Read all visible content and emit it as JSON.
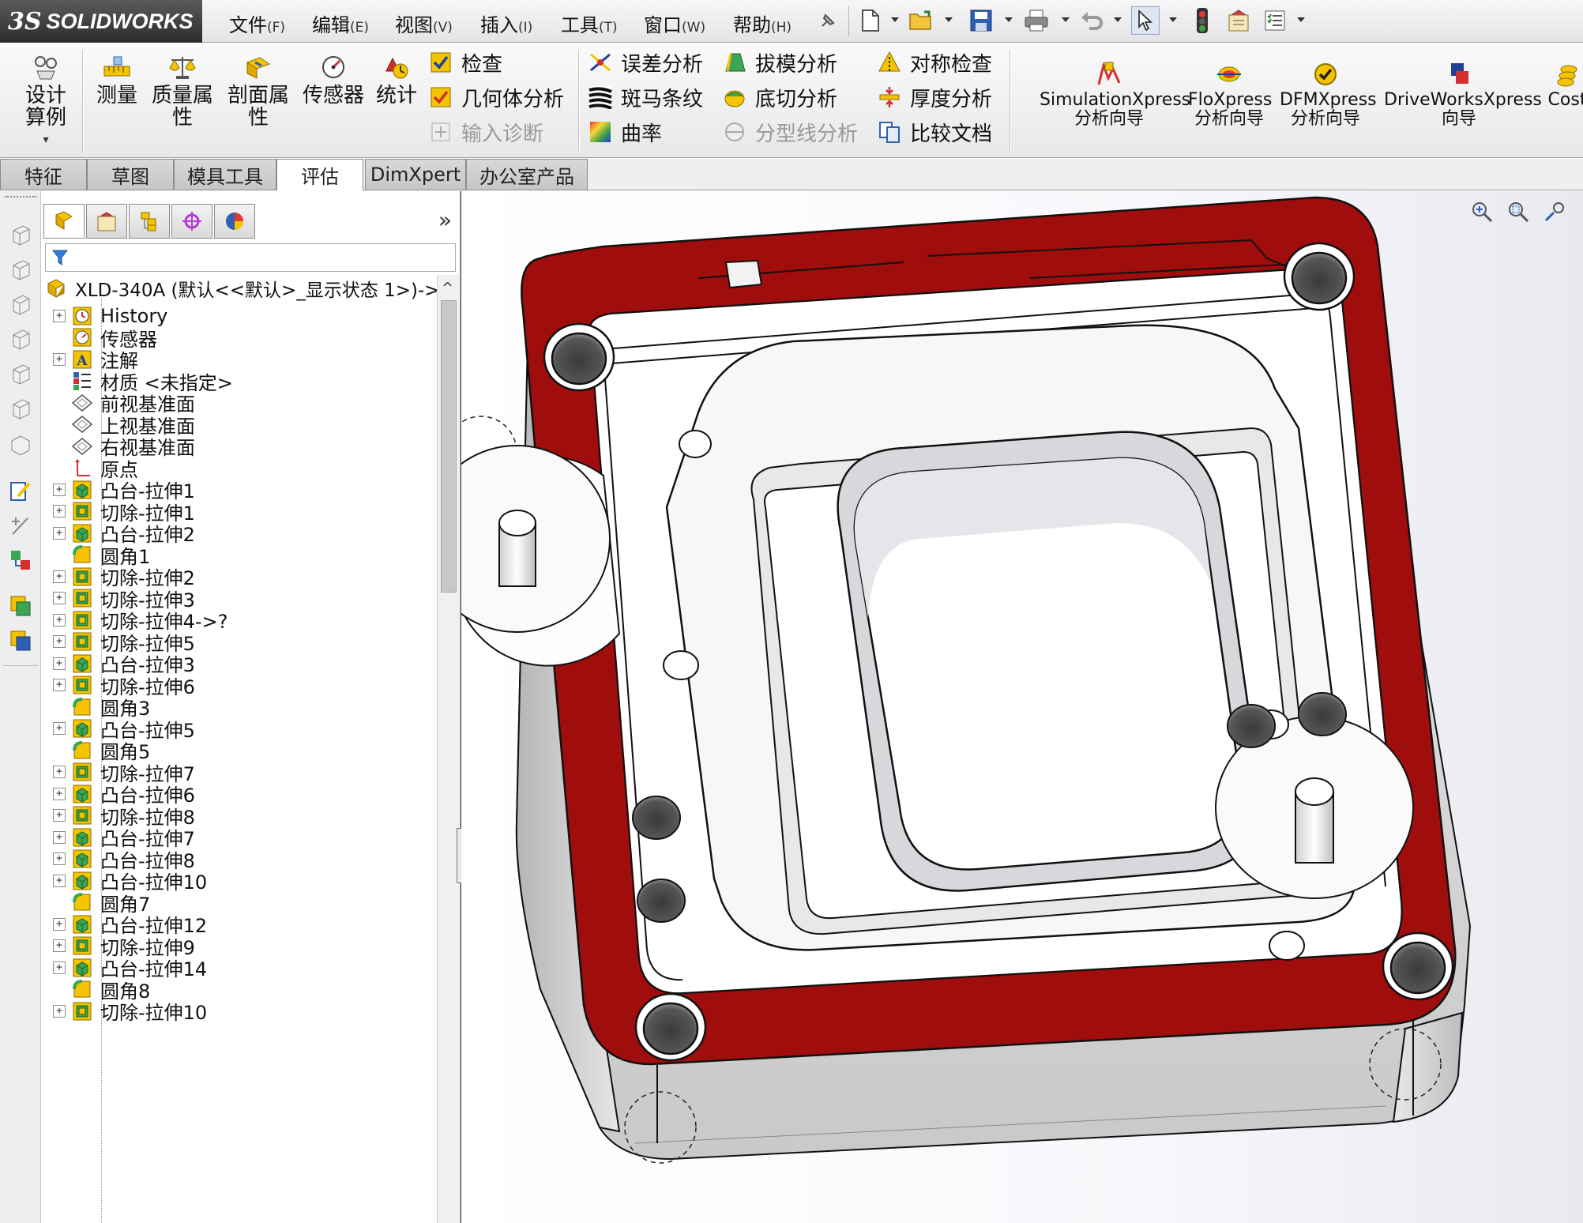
{
  "app": {
    "logo_prefix": "3S",
    "logo_name": "SOLIDWORKS"
  },
  "menu": [
    {
      "label": "文件",
      "key": "(F)"
    },
    {
      "label": "编辑",
      "key": "(E)"
    },
    {
      "label": "视图",
      "key": "(V)"
    },
    {
      "label": "插入",
      "key": "(I)"
    },
    {
      "label": "工具",
      "key": "(T)"
    },
    {
      "label": "窗口",
      "key": "(W)"
    },
    {
      "label": "帮助",
      "key": "(H)"
    }
  ],
  "commands": {
    "large": [
      "设计算例",
      "测量",
      "质量属性",
      "剖面属性",
      "传感器",
      "统计"
    ],
    "col1": [
      "检查",
      "几何体分析",
      "输入诊断"
    ],
    "col2": [
      "误差分析",
      "斑马条纹",
      "曲率"
    ],
    "col3": [
      "拔模分析",
      "底切分析",
      "分型线分析"
    ],
    "col4": [
      "对称检查",
      "厚度分析",
      "比较文档"
    ],
    "xpress": [
      "SimulationXpress 分析向导",
      "FloXpress 分析向导",
      "DFMXpress 分析向导",
      "DriveWorksXpress 向导",
      "Cost"
    ]
  },
  "tabs": [
    "特征",
    "草图",
    "模具工具",
    "评估",
    "DimXpert",
    "办公室产品"
  ],
  "active_tab": "评估",
  "tree": {
    "root": "XLD-340A  (默认<<默认>_显示状态 1>)->",
    "items": [
      {
        "label": "History",
        "icon": "history-icon",
        "exp": true
      },
      {
        "label": "传感器",
        "icon": "sensor-icon",
        "exp": false
      },
      {
        "label": "注解",
        "icon": "annotation-icon",
        "exp": true
      },
      {
        "label": "材质 <未指定>",
        "icon": "material-icon",
        "exp": false
      },
      {
        "label": "前视基准面",
        "icon": "plane-icon",
        "exp": false
      },
      {
        "label": "上视基准面",
        "icon": "plane-icon",
        "exp": false
      },
      {
        "label": "右视基准面",
        "icon": "plane-icon",
        "exp": false
      },
      {
        "label": "原点",
        "icon": "origin-icon",
        "exp": false
      },
      {
        "label": "凸台-拉伸1",
        "icon": "boss-extrude-icon",
        "exp": true
      },
      {
        "label": "切除-拉伸1",
        "icon": "cut-extrude-icon",
        "exp": true
      },
      {
        "label": "凸台-拉伸2",
        "icon": "boss-extrude-icon",
        "exp": true
      },
      {
        "label": "圆角1",
        "icon": "fillet-icon",
        "exp": false
      },
      {
        "label": "切除-拉伸2",
        "icon": "cut-extrude-icon",
        "exp": true
      },
      {
        "label": "切除-拉伸3",
        "icon": "cut-extrude-icon",
        "exp": true
      },
      {
        "label": "切除-拉伸4->?",
        "icon": "cut-extrude-icon",
        "exp": true
      },
      {
        "label": "切除-拉伸5",
        "icon": "cut-extrude-icon",
        "exp": true
      },
      {
        "label": "凸台-拉伸3",
        "icon": "boss-extrude-icon",
        "exp": true
      },
      {
        "label": "切除-拉伸6",
        "icon": "cut-extrude-icon",
        "exp": true
      },
      {
        "label": "圆角3",
        "icon": "fillet-icon",
        "exp": false
      },
      {
        "label": "凸台-拉伸5",
        "icon": "boss-extrude-icon",
        "exp": true
      },
      {
        "label": "圆角5",
        "icon": "fillet-icon",
        "exp": false
      },
      {
        "label": "切除-拉伸7",
        "icon": "cut-extrude-icon",
        "exp": true
      },
      {
        "label": "凸台-拉伸6",
        "icon": "boss-extrude-icon",
        "exp": true
      },
      {
        "label": "切除-拉伸8",
        "icon": "cut-extrude-icon",
        "exp": true
      },
      {
        "label": "凸台-拉伸7",
        "icon": "boss-extrude-icon",
        "exp": true
      },
      {
        "label": "凸台-拉伸8",
        "icon": "boss-extrude-icon",
        "exp": true
      },
      {
        "label": "凸台-拉伸10",
        "icon": "boss-extrude-icon",
        "exp": true
      },
      {
        "label": "圆角7",
        "icon": "fillet-icon",
        "exp": false
      },
      {
        "label": "凸台-拉伸12",
        "icon": "boss-extrude-icon",
        "exp": true
      },
      {
        "label": "切除-拉伸9",
        "icon": "cut-extrude-icon",
        "exp": true
      },
      {
        "label": "凸台-拉伸14",
        "icon": "boss-extrude-icon",
        "exp": true
      },
      {
        "label": "圆角8",
        "icon": "fillet-icon",
        "exp": false
      },
      {
        "label": "切除-拉伸10",
        "icon": "cut-extrude-icon",
        "exp": true
      }
    ]
  },
  "colors": {
    "part_top_face": "#a00d0d",
    "part_side": "#dcdcdc",
    "accent_yellow": "#f5c400"
  }
}
